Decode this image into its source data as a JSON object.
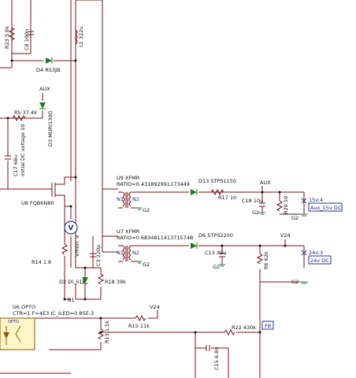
{
  "components": {
    "r23": "R23 5.6k",
    "c8": "C8 100n",
    "l1": "L1 322u",
    "d4": "D4 RS3JB",
    "aux_top": "AUX",
    "r5": "R5 37.4k",
    "d3": "D3 MURI130G",
    "c17": "C17 68u",
    "c17_ic": "Initial DC voltage 10",
    "u9": "U9 XFMR",
    "u9_ratio": "RATIO=0.431892991173449",
    "d13": "D13 STPS1150",
    "r17": "R17 10",
    "aux_right": "AUX",
    "c18": "C18 10u",
    "r20": "R20 10",
    "g2_u9": "G2",
    "g2_c18": "G2",
    "g2_r20": "G2",
    "v15": "15v:4",
    "aux15": "Aux_15v DC",
    "u8": "U8 FQB6N80",
    "u7": "U7 XFMR",
    "u7_ratio": "RATIO=0.683481141371574B",
    "d6": "D6 STPS2200",
    "v24_right": "V24",
    "c13": "C13 39u",
    "r6": "R6 62k",
    "g2_u7": "G2",
    "g2_c13": "G2",
    "g2_r6": "G2",
    "v24_3": "24v:3",
    "v24dc": "24v DC",
    "r14": "R14 1.8",
    "vmon": "Vmon: 9",
    "c3": "C3 220p",
    "d2": "D2 DI_S1K",
    "r18": "R18 39k",
    "node_b1": "B1",
    "u6": "U6 OPTO",
    "u6_params": "CTR=1 F=4E3 IC_ILED=0.85E-3",
    "v24_bottom": "V24",
    "r15": "R15 11k",
    "r13": "R13 1.5k",
    "r22": "R22 430k",
    "fb": "FB",
    "c15": "C15 6.8n",
    "opto_box": "OPTO",
    "n1_top": "N1",
    "n2_top": "N2",
    "n1_bot": "N1",
    "n2_bot": "N2",
    "v_meter": "V"
  }
}
